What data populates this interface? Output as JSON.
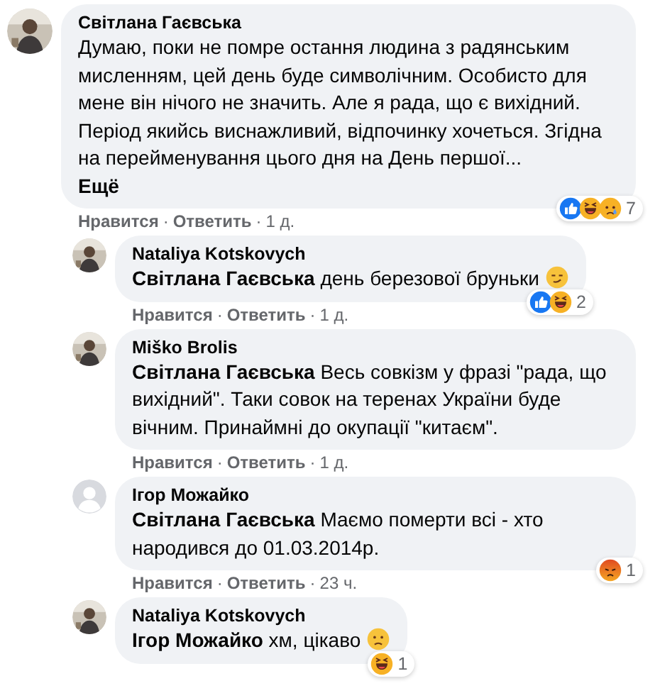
{
  "comments": [
    {
      "kind": "top",
      "author": "Світлана Гаєвська",
      "text": "Думаю, поки не помре остання людина з радянським мисленням, цей день буде символічним. Особисто для мене він нічого не значить. Але я рада, що є вихідний. Період якийсь виснажливий, відпочинку хочеться. Згідна на перейменування цього дня на День першої...",
      "more": "Ещё",
      "reactions": {
        "icons": [
          {
            "kind": "like"
          },
          {
            "kind": "haha"
          },
          {
            "kind": "sad"
          }
        ],
        "count": "7"
      },
      "actions": [
        {
          "kind": "link",
          "text": "Нравится"
        },
        {
          "kind": "separator",
          "text": "·"
        },
        {
          "kind": "link",
          "text": "Ответить"
        },
        {
          "kind": "separator",
          "text": "·"
        },
        {
          "kind": "time",
          "text": "1 д."
        }
      ]
    },
    {
      "kind": "reply",
      "author": "Nataliya Kotskovych",
      "text": "**Світлана Гаєвська** день березової бруньки",
      "emoji": {
        "kind": "smirk"
      },
      "reactions": {
        "icons": [
          {
            "kind": "like"
          },
          {
            "kind": "haha"
          }
        ],
        "count": "2"
      },
      "actions": [
        {
          "kind": "link",
          "text": "Нравится"
        },
        {
          "kind": "separator",
          "text": "·"
        },
        {
          "kind": "link",
          "text": "Ответить"
        },
        {
          "kind": "separator",
          "text": "·"
        },
        {
          "kind": "time",
          "text": "1 д."
        }
      ]
    },
    {
      "kind": "reply",
      "author": "Miško Brolis",
      "text": "**Світлана Гаєвська** Весь совкізм у фразі \"рада, що вихідний\". Таки совок на теренах України буде вічним. Принаймні до окупації \"китаєм\".",
      "actions": [
        {
          "kind": "link",
          "text": "Нравится"
        },
        {
          "kind": "separator",
          "text": "·"
        },
        {
          "kind": "link",
          "text": "Ответить"
        },
        {
          "kind": "separator",
          "text": "·"
        },
        {
          "kind": "time",
          "text": "1 д."
        }
      ]
    },
    {
      "kind": "reply",
      "avatar": {
        "kind": "default"
      },
      "author": "Ігор Можайко",
      "text": "**Світлана Гаєвська** Маємо померти всі - хто народився до 01.03.2014р.",
      "reactions": {
        "icons": [
          {
            "kind": "angry"
          }
        ],
        "count": "1"
      },
      "actions": [
        {
          "kind": "link",
          "text": "Нравится"
        },
        {
          "kind": "separator",
          "text": "·"
        },
        {
          "kind": "link",
          "text": "Ответить"
        },
        {
          "kind": "separator",
          "text": "·"
        },
        {
          "kind": "time",
          "text": "23 ч."
        }
      ]
    },
    {
      "kind": "reply",
      "author": "Nataliya Kotskovych",
      "text": "**Ігор Можайко** хм, цікаво",
      "emoji": {
        "kind": "worried"
      },
      "reactions": {
        "icons": [
          {
            "kind": "haha"
          }
        ],
        "count": "1"
      }
    }
  ]
}
